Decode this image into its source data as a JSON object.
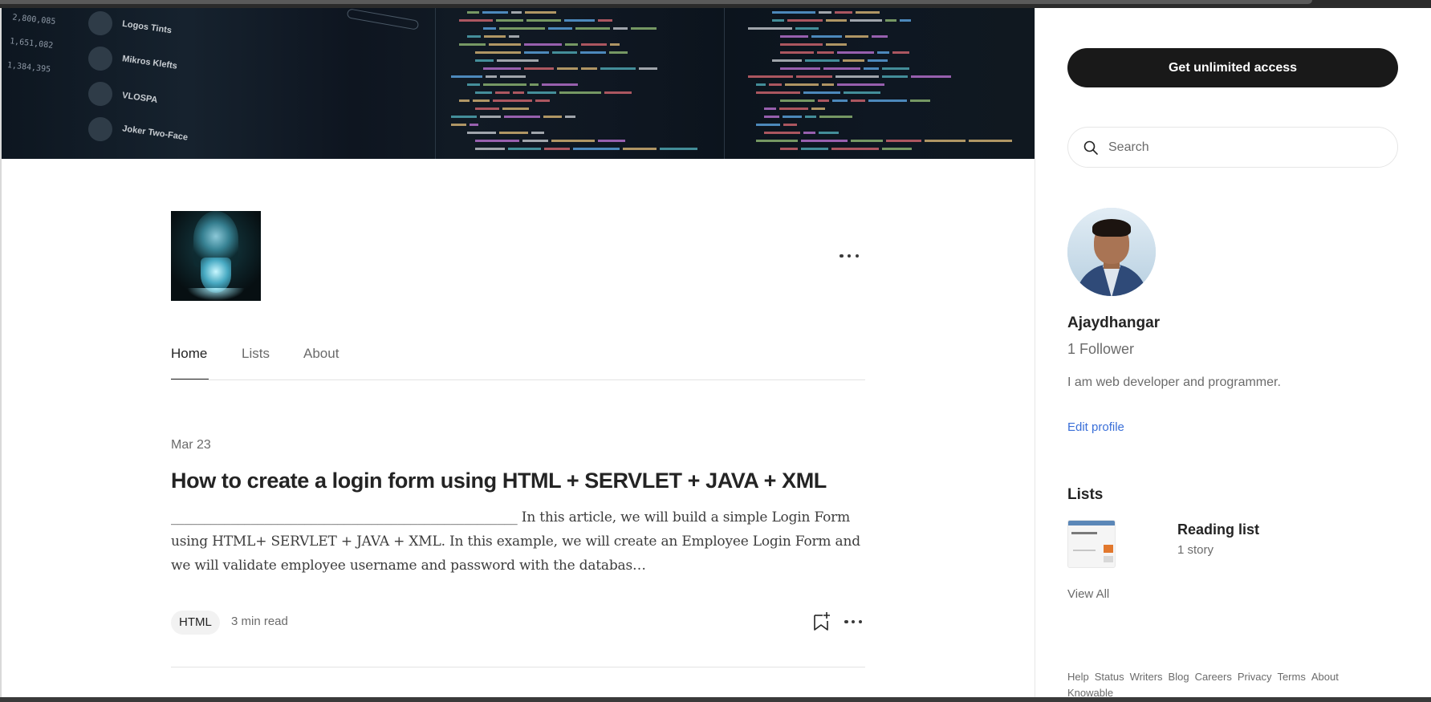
{
  "publication": {
    "logo_alt": "hooded hacker figure with glowing shield"
  },
  "tabs": [
    {
      "label": "Home",
      "active": true
    },
    {
      "label": "Lists",
      "active": false
    },
    {
      "label": "About",
      "active": false
    }
  ],
  "post": {
    "date": "Mar 23",
    "title": "How to create a login form using HTML + SERVLET + JAVA + XML",
    "excerpt": "____________________________________________________ In this article, we will build a simple Login Form using HTML+ SERVLET + JAVA + XML. In this example, we will create an Employee Login Form and we will validate employee username and password with the databas…",
    "tag": "HTML",
    "read_time": "3 min read"
  },
  "sidebar": {
    "cta_label": "Get unlimited access",
    "search_placeholder": "Search",
    "author": {
      "name": "Ajaydhangar",
      "followers": "1 Follower",
      "bio": "I am web developer and programmer.",
      "edit_label": "Edit profile"
    },
    "lists": {
      "heading": "Lists",
      "items": [
        {
          "name": "Reading list",
          "count": "1 story"
        }
      ],
      "view_all": "View All"
    },
    "footer_links": [
      "Help",
      "Status",
      "Writers",
      "Blog",
      "Careers",
      "Privacy",
      "Terms",
      "About",
      "Knowable"
    ]
  },
  "banner": {
    "names": [
      "Logos Tints",
      "Mikros Klefts",
      "VLOSPA",
      "Joker Two-Face"
    ],
    "numbers": [
      "2,800,085",
      "1,651,082",
      "1,384,395"
    ]
  },
  "colors": {
    "cta_bg": "#191919",
    "link": "#3a6fd8",
    "muted": "#6b6b6b",
    "text": "#242424"
  },
  "icons": {
    "search": "search-icon",
    "bookmark": "bookmark-add-icon",
    "more": "more-horizontal-icon"
  }
}
